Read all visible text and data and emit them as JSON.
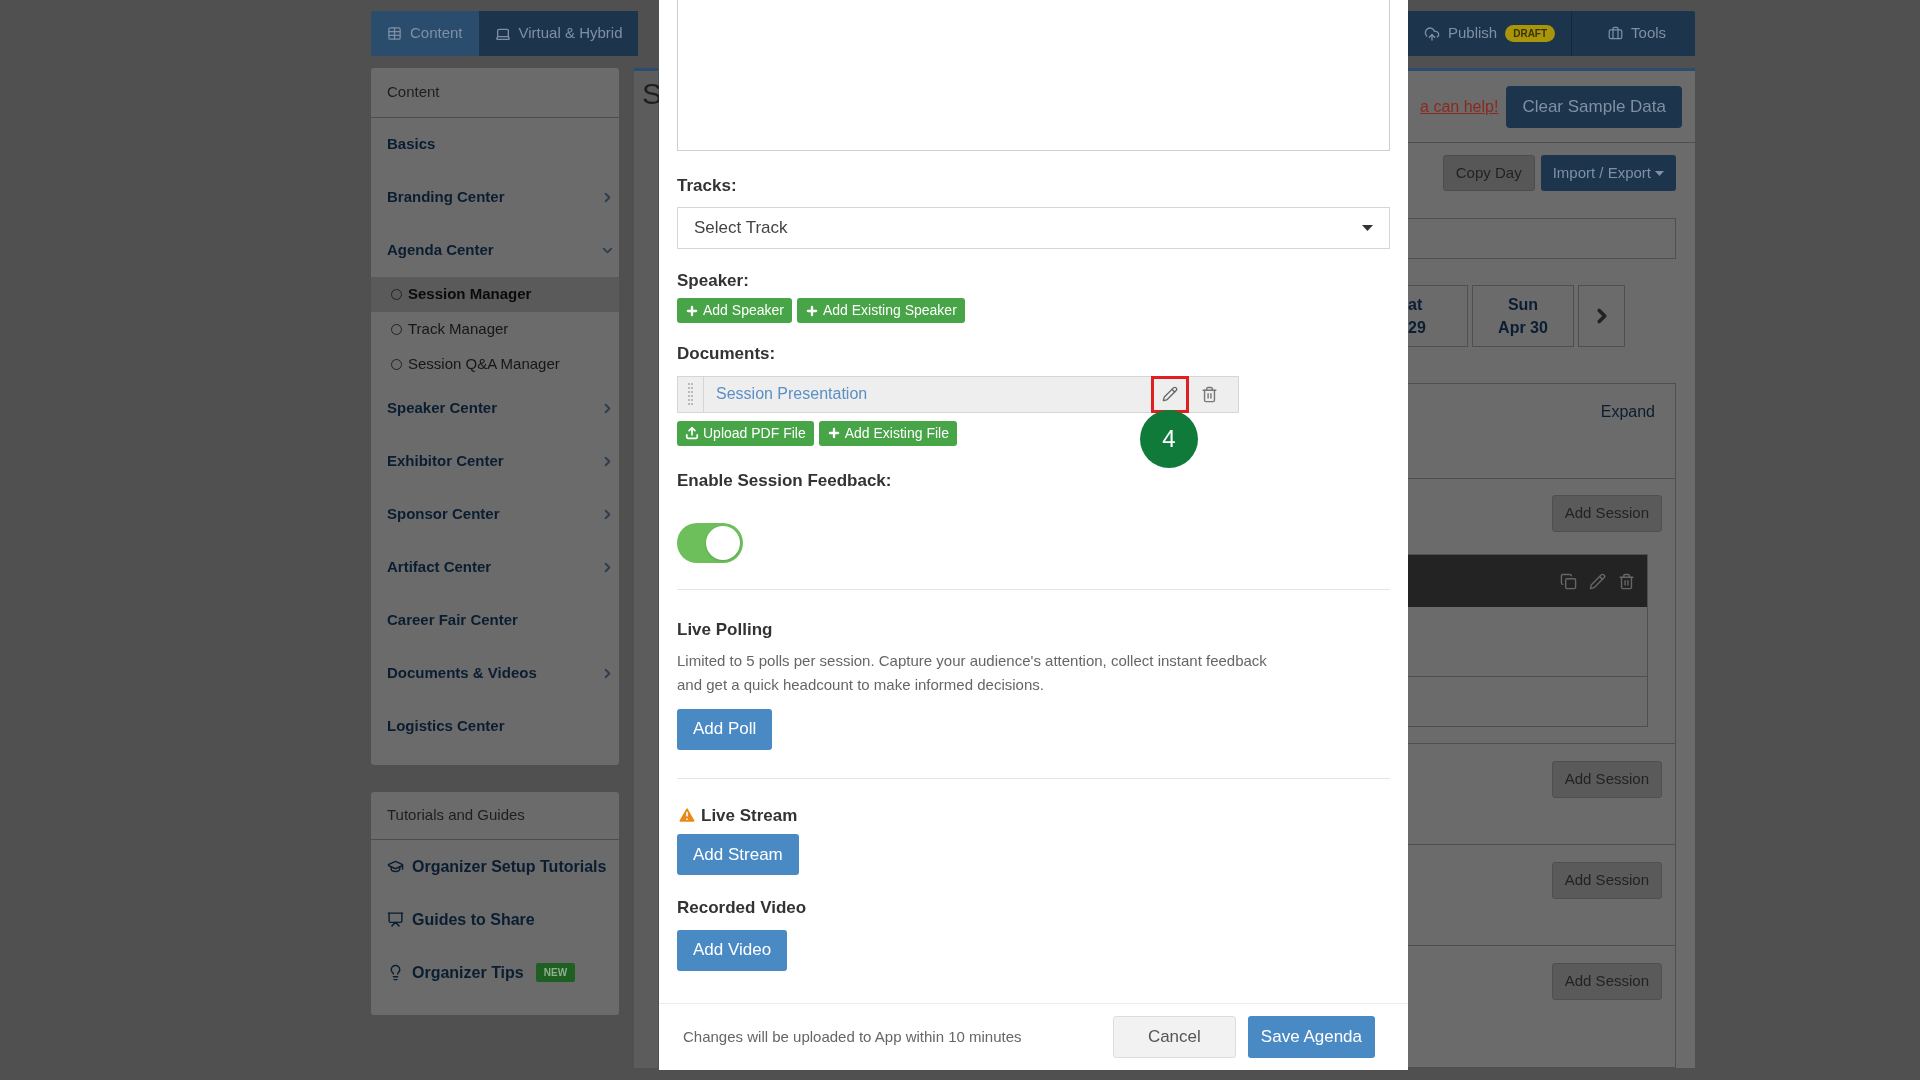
{
  "nav": {
    "left": [
      {
        "label": "Content",
        "selected": true
      },
      {
        "label": "Virtual & Hybrid",
        "selected": false
      }
    ],
    "right": [
      {
        "label": "Publish",
        "badge": "DRAFT",
        "selected": false
      },
      {
        "label": "Tools",
        "selected": false
      }
    ]
  },
  "sidebar": {
    "header": "Content",
    "items": [
      {
        "label": "Basics",
        "kind": "link",
        "selected": false
      },
      {
        "label": "Branding Center",
        "kind": "group",
        "expanded": false,
        "selected": false
      },
      {
        "label": "Agenda Center",
        "kind": "group",
        "expanded": true,
        "selected": false
      },
      {
        "label": "Session Manager",
        "kind": "sub",
        "selected": true
      },
      {
        "label": "Track Manager",
        "kind": "sub",
        "selected": false
      },
      {
        "label": "Session Q&A Manager",
        "kind": "sub",
        "selected": false
      },
      {
        "label": "Speaker Center",
        "kind": "group",
        "expanded": false,
        "selected": false
      },
      {
        "label": "Exhibitor Center",
        "kind": "group",
        "expanded": false,
        "selected": false
      },
      {
        "label": "Sponsor Center",
        "kind": "group",
        "expanded": false,
        "selected": false
      },
      {
        "label": "Artifact Center",
        "kind": "group",
        "expanded": false,
        "selected": false
      },
      {
        "label": "Career Fair Center",
        "kind": "link",
        "selected": false
      },
      {
        "label": "Documents & Videos",
        "kind": "group",
        "expanded": false,
        "selected": false
      },
      {
        "label": "Logistics Center",
        "kind": "link",
        "selected": false
      }
    ]
  },
  "guides": {
    "header": "Tutorials and Guides",
    "items": [
      {
        "label": "Organizer Setup Tutorials"
      },
      {
        "label": "Guides to Share"
      },
      {
        "label": "Organizer Tips",
        "badge": "NEW"
      }
    ]
  },
  "page": {
    "title": "S",
    "help_link": "a can help!",
    "clear_button": "Clear Sample Data",
    "copy_day": "Copy Day",
    "import_export": "Import / Export",
    "days": [
      {
        "day": "at",
        "date": "29",
        "selected": false
      },
      {
        "day": "Sun",
        "date": "Apr 30",
        "selected": false
      }
    ],
    "expand": "Expand",
    "add_session": [
      "Add Session",
      "Add Session",
      "Add Session",
      "Add Session"
    ]
  },
  "modal": {
    "tracks": {
      "label": "Tracks:",
      "value": "Select Track"
    },
    "speaker": {
      "label": "Speaker:",
      "buttons": [
        "Add Speaker",
        "Add Existing Speaker"
      ]
    },
    "documents": {
      "label": "Documents:",
      "files": [
        {
          "name": "Session Presentation"
        }
      ],
      "buttons": [
        "Upload PDF File",
        "Add Existing File"
      ]
    },
    "feedback": {
      "label": "Enable Session Feedback:",
      "on": true
    },
    "callout": "4",
    "live_polling": {
      "title": "Live Polling",
      "description": "Limited to 5 polls per session. Capture your audience's attention, collect instant feedback and get a quick headcount to make informed decisions.",
      "button": "Add Poll"
    },
    "live_stream": {
      "title": "Live Stream",
      "button": "Add Stream"
    },
    "recorded_video": {
      "title": "Recorded Video",
      "button": "Add Video"
    },
    "footer": {
      "note": "Changes will be uploaded to App within 10 minutes",
      "cancel": "Cancel",
      "save": "Save Agenda"
    }
  }
}
